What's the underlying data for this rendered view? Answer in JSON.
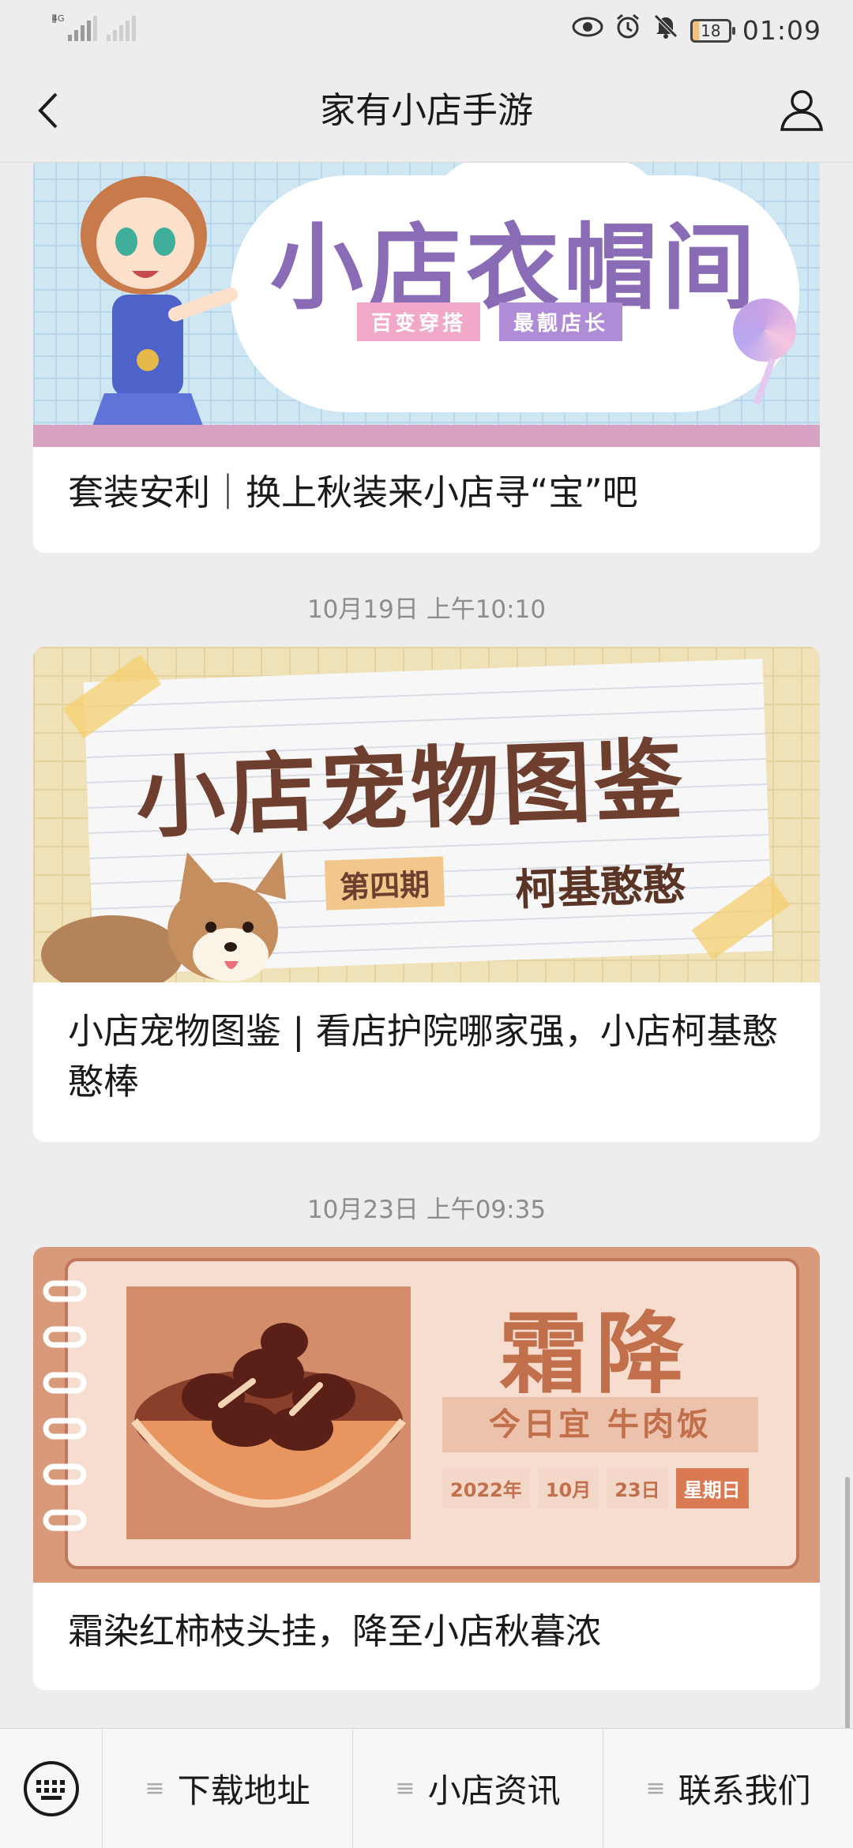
{
  "status_bar": {
    "network_label": "4G",
    "time": "01:09",
    "battery": "18"
  },
  "nav": {
    "title": "家有小店手游"
  },
  "feed": [
    {
      "title": "套装安利｜换上秋装来小店寻“宝”吧",
      "banner": {
        "heading": "小店衣帽间",
        "tag1": "百变穿搭",
        "tag2": "最靓店长"
      }
    },
    {
      "timestamp": "10月19日 上午10:10",
      "title": "小店宠物图鉴 | 看店护院哪家强，小店柯基憨憨棒",
      "banner": {
        "heading": "小店宠物图鉴",
        "issue": "第四期",
        "pet": "柯基憨憨"
      }
    },
    {
      "timestamp": "10月23日 上午09:35",
      "title": "霜染红柿枝头挂，降至小店秋暮浓",
      "banner": {
        "heading": "霜降",
        "subtitle": "今日宜 牛肉饭",
        "year": "2022年",
        "month": "10月",
        "day": "23日",
        "weekday": "星期日"
      }
    }
  ],
  "bottom_menu": {
    "items": [
      {
        "label": "下载地址",
        "icon": "menu-lines-icon"
      },
      {
        "label": "小店资讯",
        "icon": "menu-lines-icon"
      },
      {
        "label": "联系我们",
        "icon": "menu-lines-icon"
      }
    ]
  },
  "colors": {
    "background": "#ededed",
    "card": "#ffffff",
    "timestamp": "#8c8c8c"
  }
}
